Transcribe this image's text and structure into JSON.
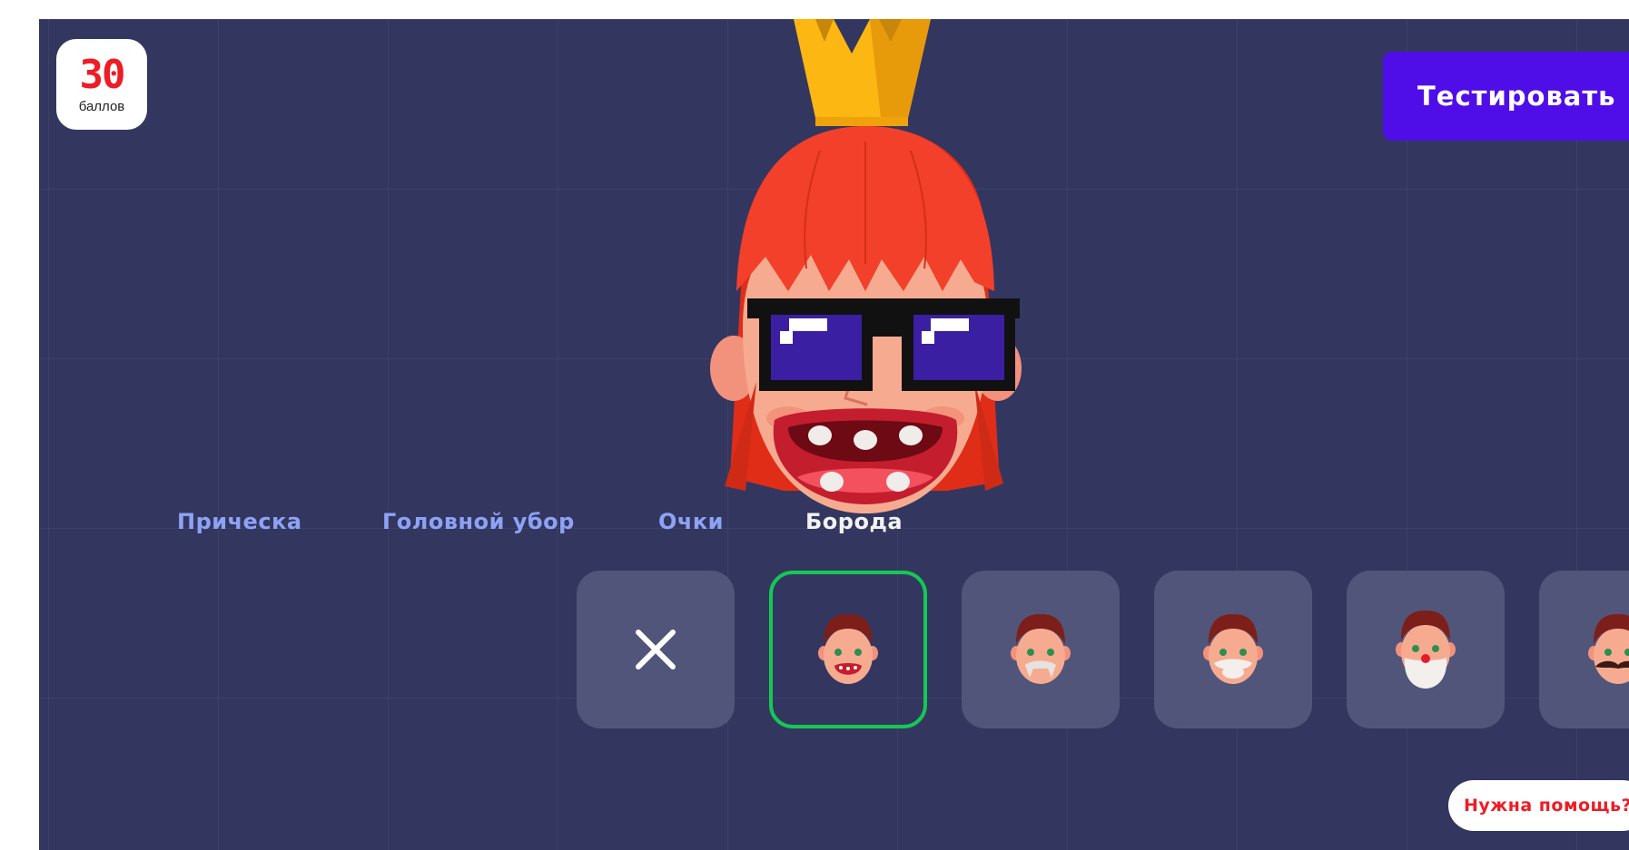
{
  "score": {
    "value": "30",
    "label": "баллов"
  },
  "header": {
    "test_button_label": "Тестировать"
  },
  "tabs": [
    {
      "label": "Прическа",
      "active": false
    },
    {
      "label": "Головной убор",
      "active": false
    },
    {
      "label": "Очки",
      "active": false
    },
    {
      "label": "Борода",
      "active": true
    }
  ],
  "beard_options": [
    {
      "icon": "none-x-icon",
      "selected": false
    },
    {
      "icon": "no-beard-face-icon",
      "selected": true
    },
    {
      "icon": "grey-moustache-face-icon",
      "selected": false
    },
    {
      "icon": "white-moustache-face-icon",
      "selected": false
    },
    {
      "icon": "santa-beard-face-icon",
      "selected": false
    },
    {
      "icon": "black-moustache-face-icon",
      "selected": false
    }
  ],
  "help": {
    "label": "Нужна помощь?"
  },
  "colors": {
    "background": "#33375f",
    "accent_button": "#4f0ee8",
    "score_text": "#ee1c25",
    "selected_border": "#15c854",
    "tab_inactive": "#8ea2f5",
    "tab_active": "#f2f2f2"
  }
}
